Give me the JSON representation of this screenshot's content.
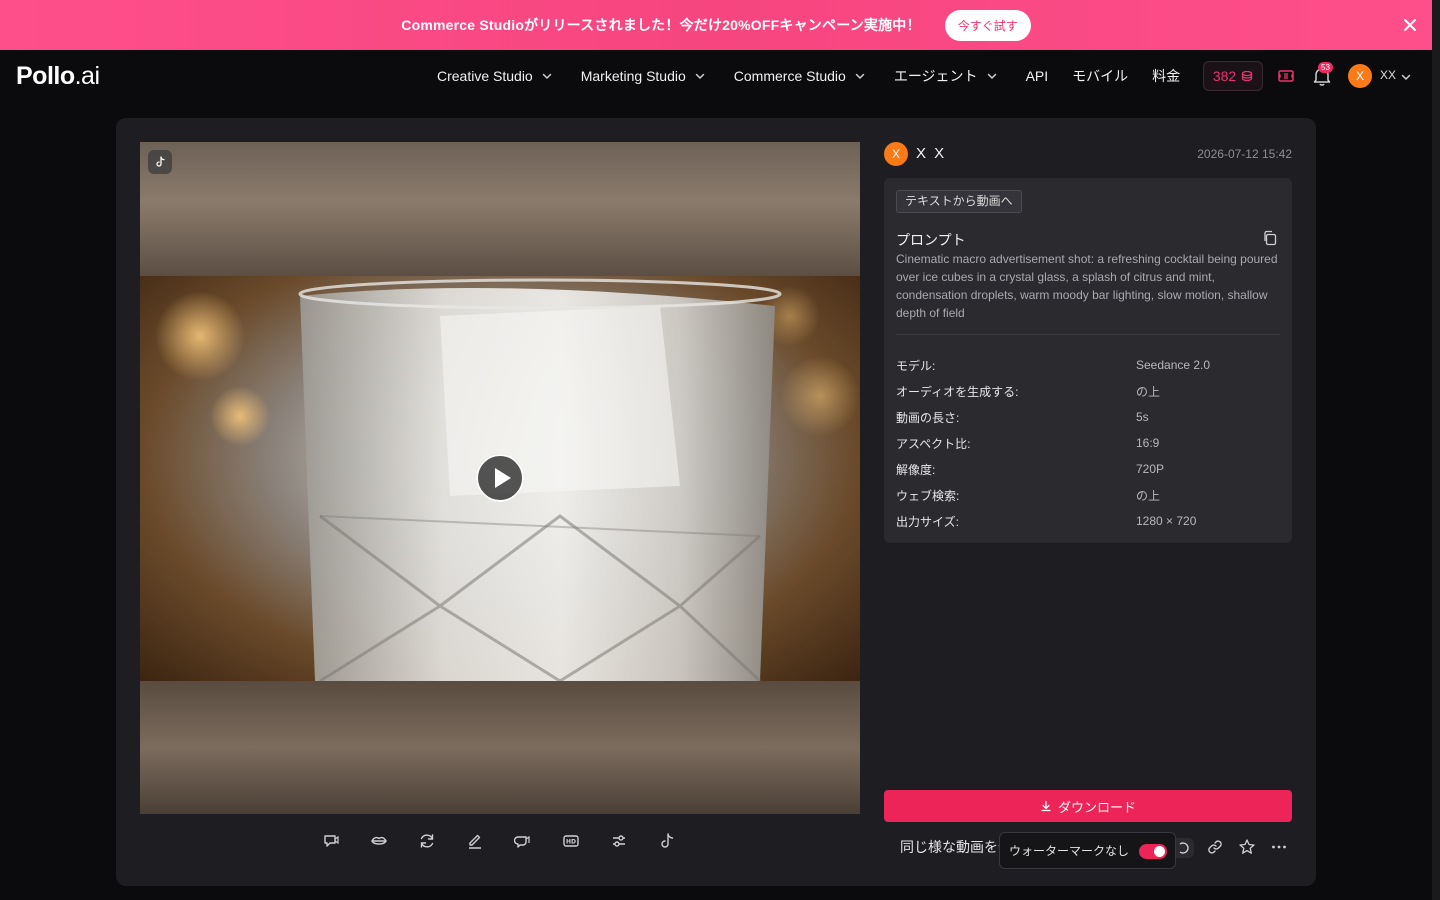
{
  "banner": {
    "text": "Commerce Studioがリリースされました！今だけ20%OFFキャンペーン実施中！",
    "cta": "今すぐ試す",
    "close_icon": "close-icon"
  },
  "nav": {
    "logo_main": "Pollo",
    "logo_suffix": ".ai",
    "items": [
      {
        "label": "Creative Studio",
        "dropdown": true
      },
      {
        "label": "Marketing Studio",
        "dropdown": true
      },
      {
        "label": "Commerce Studio",
        "dropdown": true
      },
      {
        "label": "エージェント",
        "dropdown": true
      },
      {
        "label": "API",
        "dropdown": false
      },
      {
        "label": "モバイル",
        "dropdown": false
      },
      {
        "label": "料金",
        "dropdown": false
      }
    ],
    "credits": "382",
    "notification_count": "53",
    "user_initial": "X",
    "user_name": "XX"
  },
  "author": {
    "initial": "X",
    "name": "X X",
    "date": "2026-07-12 15:42"
  },
  "info": {
    "tag": "テキストから動画へ",
    "prompt_title": "プロンプト",
    "prompt": "Cinematic macro advertisement shot: a refreshing cocktail being poured over ice cubes in a crystal glass, a splash of citrus and mint, condensation droplets, warm moody bar lighting, slow motion, shallow depth of field",
    "params": [
      {
        "label": "モデル:",
        "value": "Seedance 2.0"
      },
      {
        "label": "オーディオを生成する:",
        "value": "の上"
      },
      {
        "label": "動画の長さ:",
        "value": "5s"
      },
      {
        "label": "アスペクト比:",
        "value": "16:9"
      },
      {
        "label": "解像度:",
        "value": "720P"
      },
      {
        "label": "ウェブ検索:",
        "value": "の上"
      },
      {
        "label": "出力サイズ:",
        "value": "1280 × 720"
      }
    ]
  },
  "actions": {
    "download": "ダウンロード",
    "similar": "同じ様な動画を作る",
    "watermark": "ウォーターマークなし",
    "watermark_on": true
  },
  "colors": {
    "accent": "#ec2458",
    "banner": "#f6457f",
    "avatar": "#f97a16",
    "panel": "#1e1e22"
  }
}
